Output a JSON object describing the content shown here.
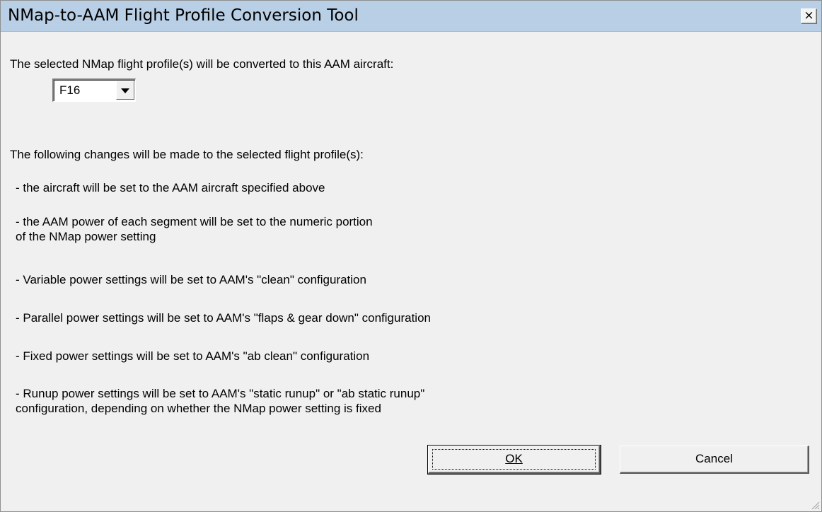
{
  "window": {
    "title": "NMap-to-AAM Flight Profile Conversion Tool",
    "close_label": "×"
  },
  "dialog": {
    "intro": "The selected NMap flight profile(s) will be converted to this AAM aircraft:",
    "aircraft_select": {
      "value": "F16"
    },
    "changes_heading": "The following changes will be made to the selected flight profile(s):",
    "changes": [
      " - the aircraft will be set to the AAM aircraft specified above",
      " - the AAM power of each segment will be set to the numeric portion",
      "   of the NMap power setting",
      " - Variable power settings will be set to AAM's \"clean\" configuration",
      " - Parallel power settings will be set to AAM's \"flaps & gear down\" configuration",
      " - Fixed power settings will be set to AAM's \"ab clean\" configuration",
      " - Runup power settings will be set to AAM's \"static runup\" or \"ab static runup\"",
      "   configuration, depending on whether the NMap power setting is fixed"
    ]
  },
  "buttons": {
    "ok_label": "OK",
    "cancel_label": "Cancel"
  }
}
